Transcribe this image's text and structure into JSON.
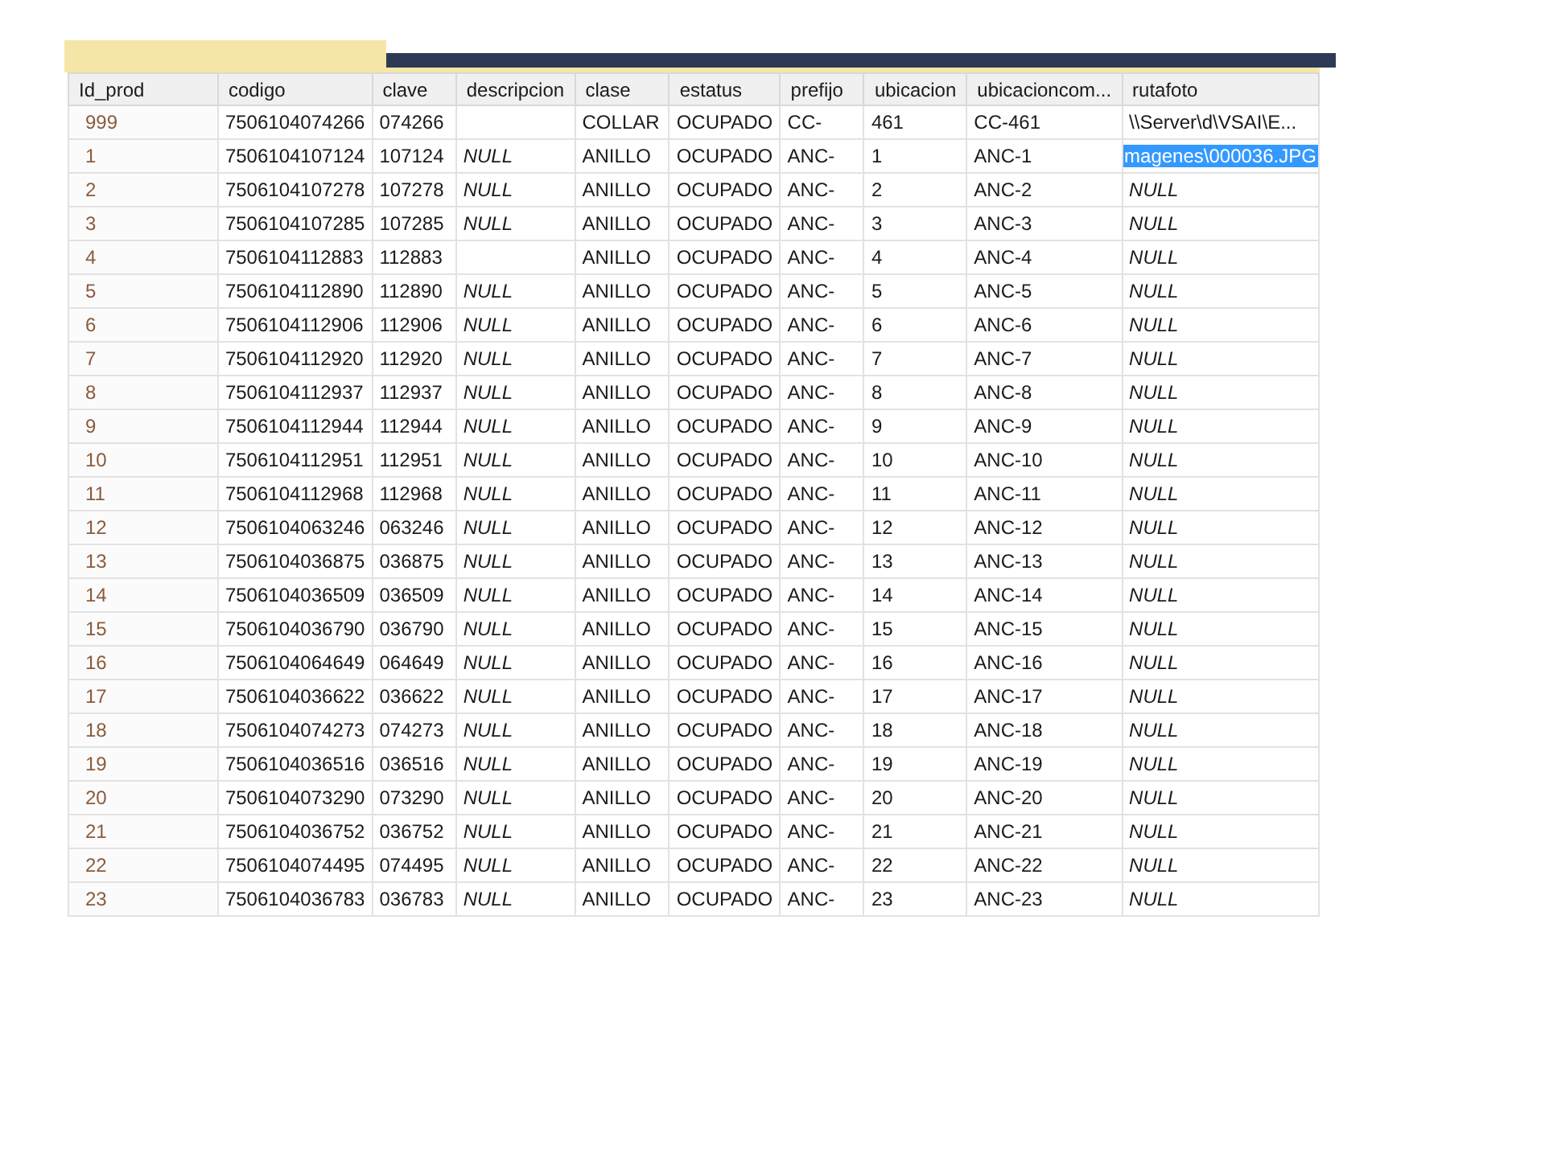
{
  "table": {
    "columns": [
      "Id_prod",
      "codigo",
      "clave",
      "descripcion",
      "clase",
      "estatus",
      "prefijo",
      "ubicacion",
      "ubicacioncom...",
      "rutafoto"
    ],
    "rows": [
      {
        "cells": [
          "999",
          "7506104074266",
          "074266",
          null,
          "COLLAR",
          "OCUPADO",
          "CC-",
          "461",
          "CC-461",
          "\\\\Server\\d\\VSAI\\E..."
        ],
        "descripcion_null": false,
        "rutafoto_null": false,
        "selected": false
      },
      {
        "cells": [
          "1",
          "7506104107124",
          "107124",
          "NULL",
          "ANILLO",
          "OCUPADO",
          "ANC-",
          "1",
          "ANC-1",
          "magenes\\000036.JPG"
        ],
        "descripcion_null": true,
        "rutafoto_null": false,
        "selected": true
      },
      {
        "cells": [
          "2",
          "7506104107278",
          "107278",
          "NULL",
          "ANILLO",
          "OCUPADO",
          "ANC-",
          "2",
          "ANC-2",
          "NULL"
        ],
        "descripcion_null": true,
        "rutafoto_null": true,
        "selected": false
      },
      {
        "cells": [
          "3",
          "7506104107285",
          "107285",
          "NULL",
          "ANILLO",
          "OCUPADO",
          "ANC-",
          "3",
          "ANC-3",
          "NULL"
        ],
        "descripcion_null": true,
        "rutafoto_null": true,
        "selected": false
      },
      {
        "cells": [
          "4",
          "7506104112883",
          "112883",
          null,
          "ANILLO",
          "OCUPADO",
          "ANC-",
          "4",
          "ANC-4",
          "NULL"
        ],
        "descripcion_null": false,
        "rutafoto_null": true,
        "selected": false
      },
      {
        "cells": [
          "5",
          "7506104112890",
          "112890",
          "NULL",
          "ANILLO",
          "OCUPADO",
          "ANC-",
          "5",
          "ANC-5",
          "NULL"
        ],
        "descripcion_null": true,
        "rutafoto_null": true,
        "selected": false
      },
      {
        "cells": [
          "6",
          "7506104112906",
          "112906",
          "NULL",
          "ANILLO",
          "OCUPADO",
          "ANC-",
          "6",
          "ANC-6",
          "NULL"
        ],
        "descripcion_null": true,
        "rutafoto_null": true,
        "selected": false
      },
      {
        "cells": [
          "7",
          "7506104112920",
          "112920",
          "NULL",
          "ANILLO",
          "OCUPADO",
          "ANC-",
          "7",
          "ANC-7",
          "NULL"
        ],
        "descripcion_null": true,
        "rutafoto_null": true,
        "selected": false
      },
      {
        "cells": [
          "8",
          "7506104112937",
          "112937",
          "NULL",
          "ANILLO",
          "OCUPADO",
          "ANC-",
          "8",
          "ANC-8",
          "NULL"
        ],
        "descripcion_null": true,
        "rutafoto_null": true,
        "selected": false
      },
      {
        "cells": [
          "9",
          "7506104112944",
          "112944",
          "NULL",
          "ANILLO",
          "OCUPADO",
          "ANC-",
          "9",
          "ANC-9",
          "NULL"
        ],
        "descripcion_null": true,
        "rutafoto_null": true,
        "selected": false
      },
      {
        "cells": [
          "10",
          "7506104112951",
          "112951",
          "NULL",
          "ANILLO",
          "OCUPADO",
          "ANC-",
          "10",
          "ANC-10",
          "NULL"
        ],
        "descripcion_null": true,
        "rutafoto_null": true,
        "selected": false
      },
      {
        "cells": [
          "11",
          "7506104112968",
          "112968",
          "NULL",
          "ANILLO",
          "OCUPADO",
          "ANC-",
          "11",
          "ANC-11",
          "NULL"
        ],
        "descripcion_null": true,
        "rutafoto_null": true,
        "selected": false
      },
      {
        "cells": [
          "12",
          "7506104063246",
          "063246",
          "NULL",
          "ANILLO",
          "OCUPADO",
          "ANC-",
          "12",
          "ANC-12",
          "NULL"
        ],
        "descripcion_null": true,
        "rutafoto_null": true,
        "selected": false
      },
      {
        "cells": [
          "13",
          "7506104036875",
          "036875",
          "NULL",
          "ANILLO",
          "OCUPADO",
          "ANC-",
          "13",
          "ANC-13",
          "NULL"
        ],
        "descripcion_null": true,
        "rutafoto_null": true,
        "selected": false
      },
      {
        "cells": [
          "14",
          "7506104036509",
          "036509",
          "NULL",
          "ANILLO",
          "OCUPADO",
          "ANC-",
          "14",
          "ANC-14",
          "NULL"
        ],
        "descripcion_null": true,
        "rutafoto_null": true,
        "selected": false
      },
      {
        "cells": [
          "15",
          "7506104036790",
          "036790",
          "NULL",
          "ANILLO",
          "OCUPADO",
          "ANC-",
          "15",
          "ANC-15",
          "NULL"
        ],
        "descripcion_null": true,
        "rutafoto_null": true,
        "selected": false
      },
      {
        "cells": [
          "16",
          "7506104064649",
          "064649",
          "NULL",
          "ANILLO",
          "OCUPADO",
          "ANC-",
          "16",
          "ANC-16",
          "NULL"
        ],
        "descripcion_null": true,
        "rutafoto_null": true,
        "selected": false
      },
      {
        "cells": [
          "17",
          "7506104036622",
          "036622",
          "NULL",
          "ANILLO",
          "OCUPADO",
          "ANC-",
          "17",
          "ANC-17",
          "NULL"
        ],
        "descripcion_null": true,
        "rutafoto_null": true,
        "selected": false
      },
      {
        "cells": [
          "18",
          "7506104074273",
          "074273",
          "NULL",
          "ANILLO",
          "OCUPADO",
          "ANC-",
          "18",
          "ANC-18",
          "NULL"
        ],
        "descripcion_null": true,
        "rutafoto_null": true,
        "selected": false
      },
      {
        "cells": [
          "19",
          "7506104036516",
          "036516",
          "NULL",
          "ANILLO",
          "OCUPADO",
          "ANC-",
          "19",
          "ANC-19",
          "NULL"
        ],
        "descripcion_null": true,
        "rutafoto_null": true,
        "selected": false
      },
      {
        "cells": [
          "20",
          "7506104073290",
          "073290",
          "NULL",
          "ANILLO",
          "OCUPADO",
          "ANC-",
          "20",
          "ANC-20",
          "NULL"
        ],
        "descripcion_null": true,
        "rutafoto_null": true,
        "selected": false
      },
      {
        "cells": [
          "21",
          "7506104036752",
          "036752",
          "NULL",
          "ANILLO",
          "OCUPADO",
          "ANC-",
          "21",
          "ANC-21",
          "NULL"
        ],
        "descripcion_null": true,
        "rutafoto_null": true,
        "selected": false
      },
      {
        "cells": [
          "22",
          "7506104074495",
          "074495",
          "NULL",
          "ANILLO",
          "OCUPADO",
          "ANC-",
          "22",
          "ANC-22",
          "NULL"
        ],
        "descripcion_null": true,
        "rutafoto_null": true,
        "selected": false
      },
      {
        "cells": [
          "23",
          "7506104036783",
          "036783",
          "NULL",
          "ANILLO",
          "OCUPADO",
          "ANC-",
          "23",
          "ANC-23",
          "NULL"
        ],
        "descripcion_null": true,
        "rutafoto_null": true,
        "selected": false
      }
    ]
  }
}
